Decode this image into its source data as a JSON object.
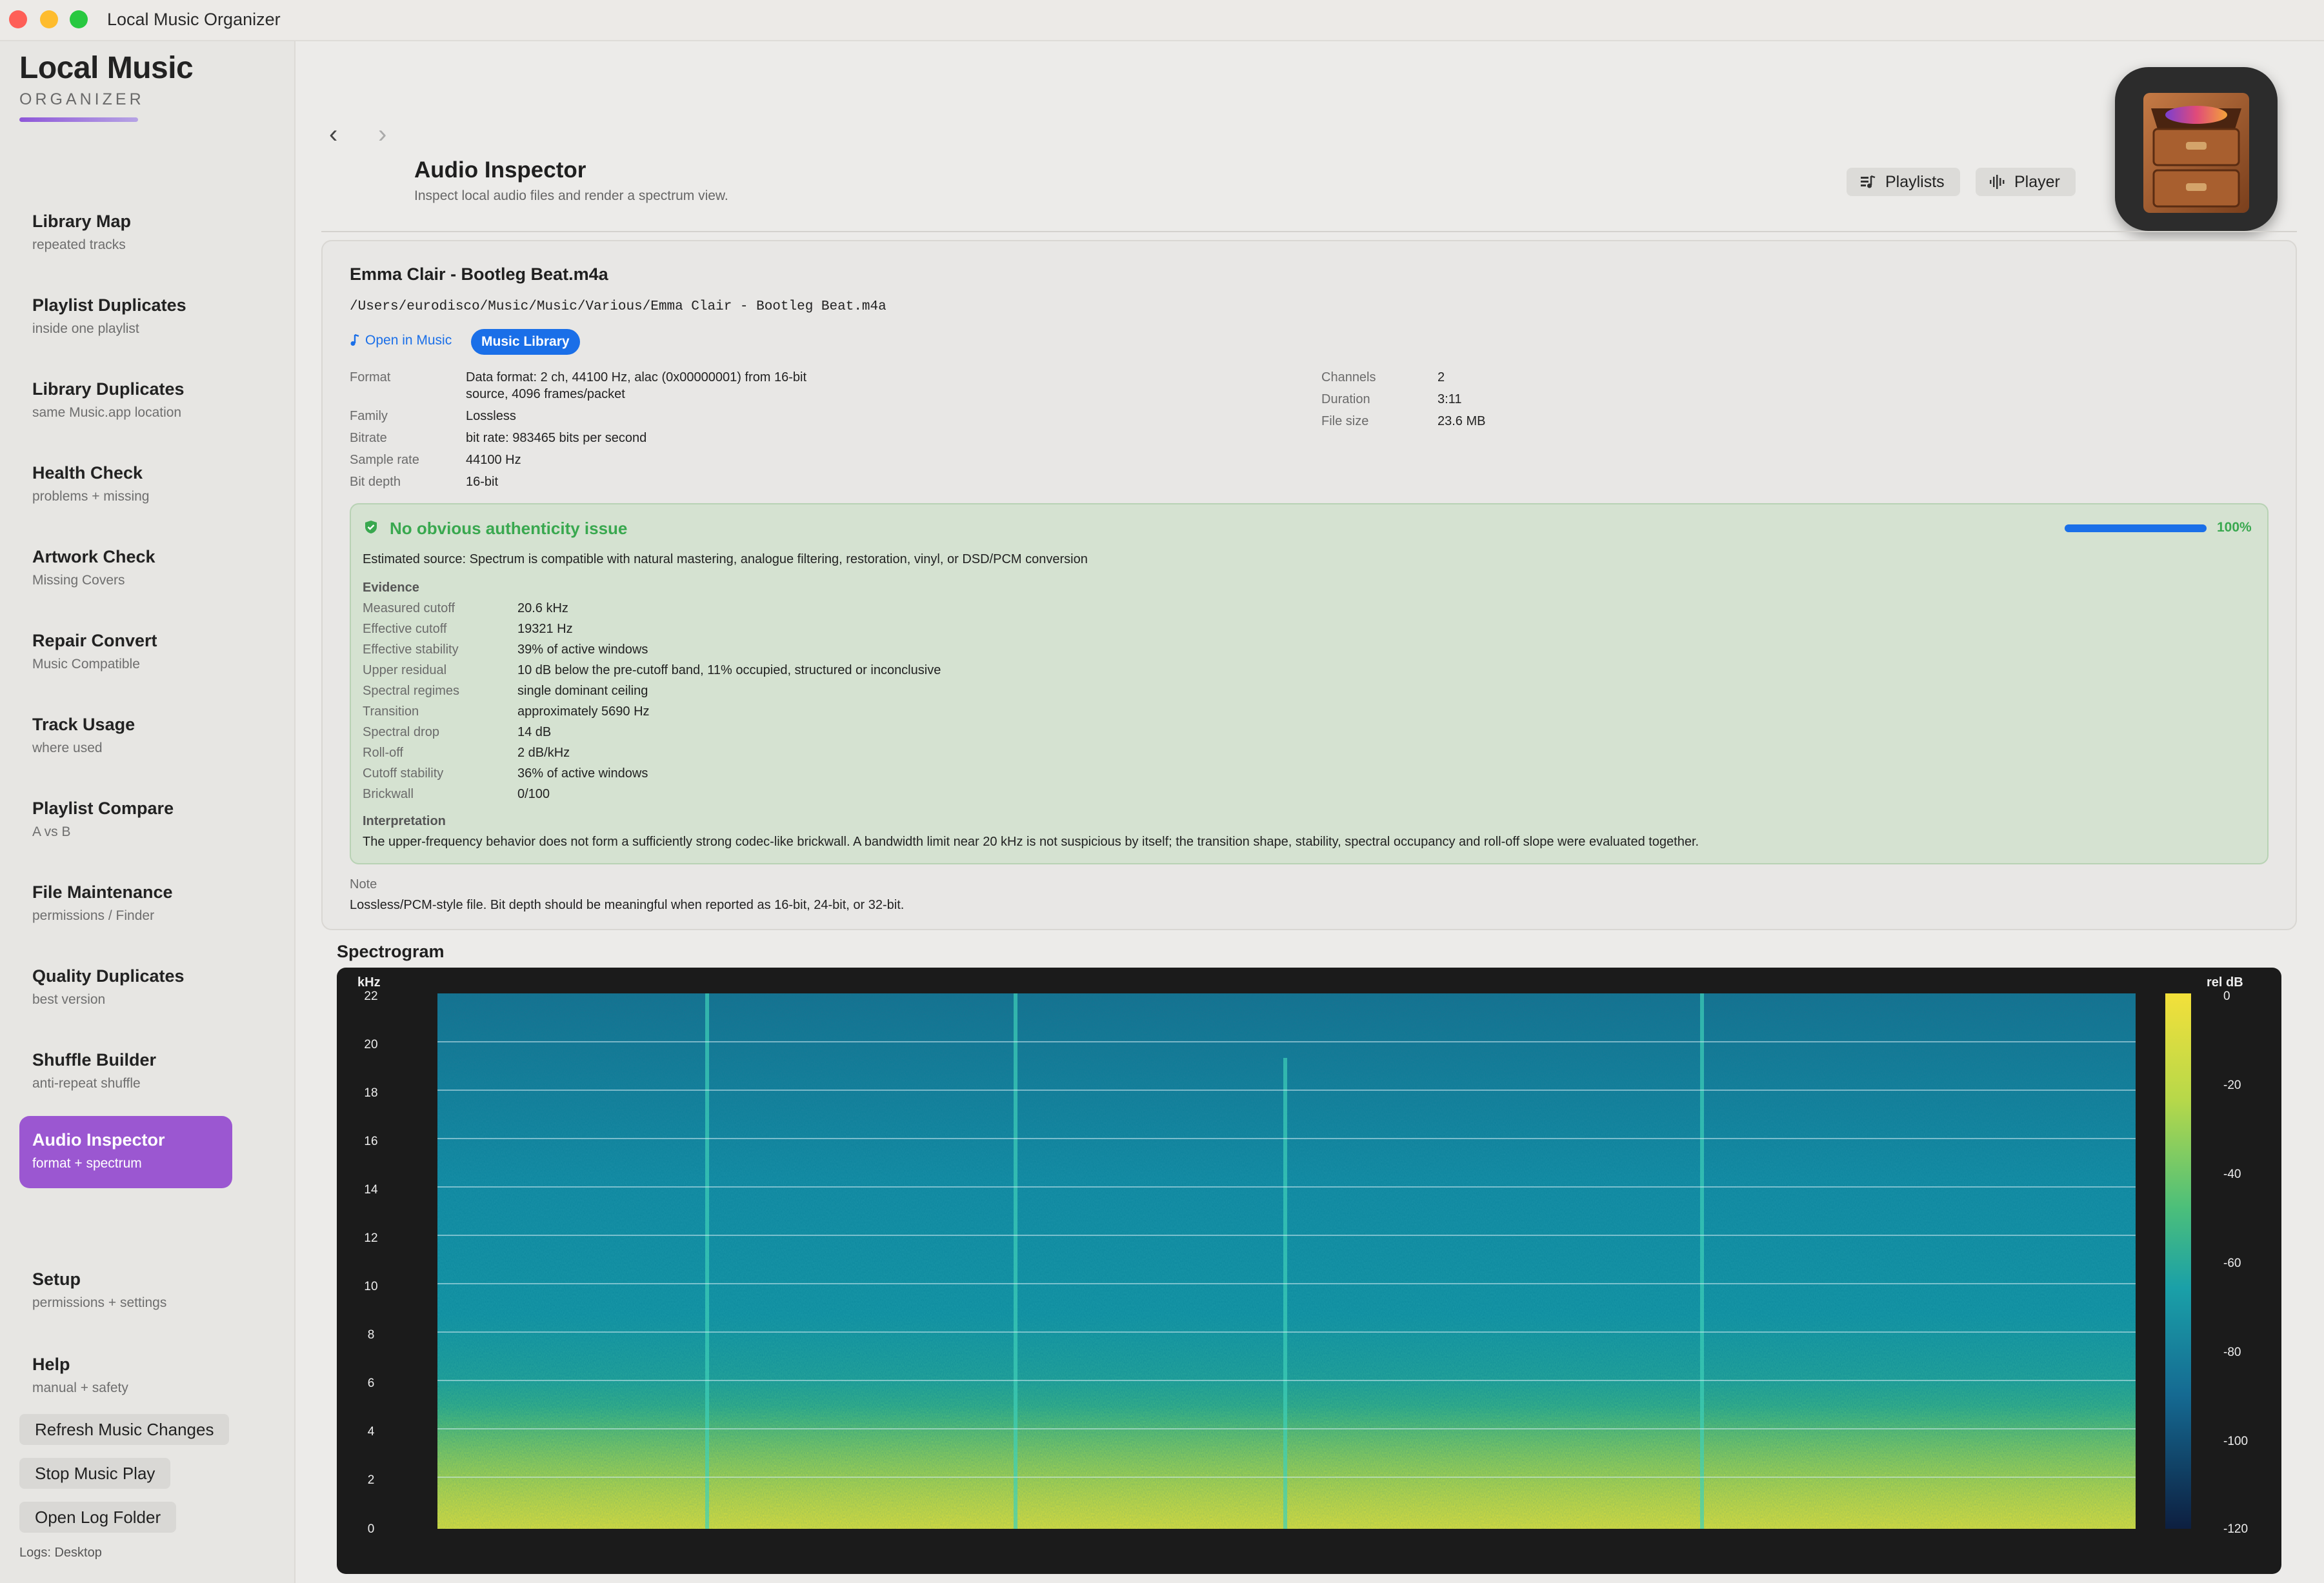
{
  "window": {
    "title": "Local Music Organizer"
  },
  "colors": {
    "accent": "#9b57d1",
    "link": "#1a6fe8",
    "ok": "#39a84f"
  },
  "brand": {
    "title": "Local Music",
    "subtitle": "ORGANIZER"
  },
  "sidebar": {
    "items": [
      {
        "label": "Library Map",
        "sub": "repeated tracks"
      },
      {
        "label": "Playlist Duplicates",
        "sub": "inside one playlist"
      },
      {
        "label": "Library Duplicates",
        "sub": "same Music.app location"
      },
      {
        "label": "Health Check",
        "sub": "problems + missing"
      },
      {
        "label": "Artwork Check",
        "sub": "Missing Covers"
      },
      {
        "label": "Repair Convert",
        "sub": "Music Compatible"
      },
      {
        "label": "Track Usage",
        "sub": "where used"
      },
      {
        "label": "Playlist Compare",
        "sub": "A vs B"
      },
      {
        "label": "File Maintenance",
        "sub": "permissions / Finder"
      },
      {
        "label": "Quality Duplicates",
        "sub": "best version"
      },
      {
        "label": "Shuffle Builder",
        "sub": "anti-repeat shuffle"
      },
      {
        "label": "Audio Inspector",
        "sub": "format + spectrum"
      }
    ],
    "secondary": [
      {
        "label": "Setup",
        "sub": "permissions + settings"
      },
      {
        "label": "Help",
        "sub": "manual + safety"
      }
    ],
    "buttons": {
      "refresh": "Refresh Music Changes",
      "stop": "Stop Music Play",
      "log": "Open Log Folder"
    },
    "logs": "Logs: Desktop"
  },
  "header": {
    "back": "‹",
    "forward": "›",
    "title": "Audio Inspector",
    "subtitle": "Inspect local audio files and render a spectrum view.",
    "playlists": "Playlists",
    "player": "Player"
  },
  "file": {
    "name": "Emma Clair - Bootleg Beat.m4a",
    "path": "/Users/eurodisco/Music/Music/Various/Emma Clair - Bootleg Beat.m4a",
    "open_in_music": "Open in Music",
    "music_library": "Music Library",
    "format_label": "Format",
    "format_line1": "Data format:     2 ch,  44100 Hz, alac (0x00000001) from 16-bit",
    "format_line2": "source, 4096 frames/packet",
    "family_label": "Family",
    "family": "Lossless",
    "bitrate_label": "Bitrate",
    "bitrate": "bit rate: 983465 bits per second",
    "sample_rate_label": "Sample rate",
    "sample_rate": "44100 Hz",
    "bit_depth_label": "Bit depth",
    "bit_depth": "16-bit",
    "channels_label": "Channels",
    "channels": "2",
    "duration_label": "Duration",
    "duration": "3:11",
    "file_size_label": "File size",
    "file_size": "23.6 MB"
  },
  "authenticity": {
    "title": "No obvious authenticity issue",
    "progress": 1.0,
    "progress_label": "100%",
    "estimate": "Estimated source: Spectrum is compatible with natural mastering, analogue filtering, restoration, vinyl, or DSD/PCM conversion",
    "evidence_label": "Evidence",
    "evidence": [
      {
        "k": "Measured cutoff",
        "v": "20.6 kHz"
      },
      {
        "k": "Effective cutoff",
        "v": "19321 Hz"
      },
      {
        "k": "Effective stability",
        "v": "39% of active windows"
      },
      {
        "k": "Upper residual",
        "v": "10 dB below the pre-cutoff band, 11% occupied, structured or inconclusive"
      },
      {
        "k": "Spectral regimes",
        "v": "single dominant ceiling"
      },
      {
        "k": "Transition",
        "v": "approximately 5690 Hz"
      },
      {
        "k": "Spectral drop",
        "v": "14 dB"
      },
      {
        "k": "Roll-off",
        "v": "2 dB/kHz"
      },
      {
        "k": "Cutoff stability",
        "v": "36% of active windows"
      },
      {
        "k": "Brickwall",
        "v": "0/100"
      }
    ],
    "interpretation_label": "Interpretation",
    "interpretation": "The upper-frequency behavior does not form a sufficiently strong codec-like brickwall. A bandwidth limit near 20 kHz is not suspicious by itself; the transition shape, stability, spectral occupancy and roll-off slope were evaluated together."
  },
  "note": {
    "label": "Note",
    "text": "Lossless/PCM-style file. Bit depth should be meaningful when reported as 16-bit, 24-bit, or 32-bit."
  },
  "spectrogram": {
    "title": "Spectrogram",
    "y_unit": "kHz",
    "y_ticks": [
      "22",
      "20",
      "18",
      "16",
      "14",
      "12",
      "10",
      "8",
      "6",
      "4",
      "2",
      "0"
    ],
    "colorbar_unit": "rel dB",
    "colorbar_ticks": [
      "0",
      "-20",
      "-40",
      "-60",
      "-80",
      "-100",
      "-120"
    ]
  }
}
